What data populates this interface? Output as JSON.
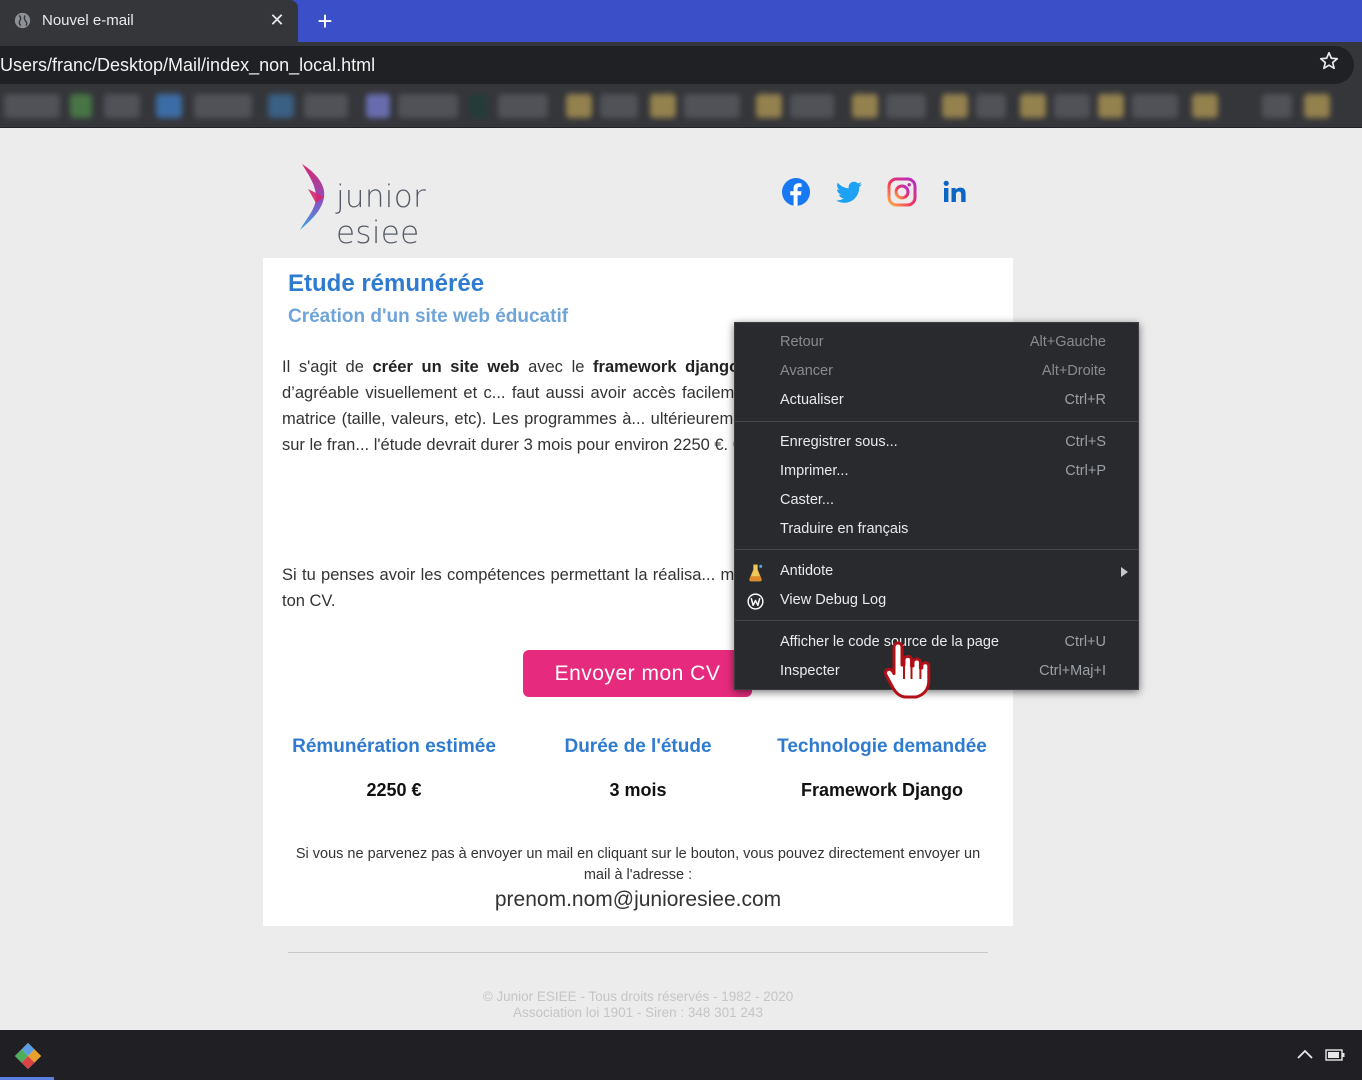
{
  "browser": {
    "tab_title": "Nouvel e-mail",
    "tab_close": "✕",
    "new_tab": "+",
    "url": "Users/franc/Desktop/Mail/index_non_local.html"
  },
  "header": {
    "logo_text": "junior esiee",
    "social": [
      "facebook-icon",
      "twitter-icon",
      "instagram-icon",
      "linkedin-icon"
    ]
  },
  "card": {
    "title": "Etude rémunérée",
    "subtitle": "Création d'un site web éducatif",
    "para1": [
      {
        "t": "Il s'agit de "
      },
      {
        "t": "créer un site web",
        "b": true
      },
      {
        "t": " avec le "
      },
      {
        "t": "framework django",
        "b": true
      },
      {
        "t": ", ... donc il faudra quelque chose d’agréable visuellement et c... faut aussi avoir accès facilement à diverses options, com... d'une matrice (taille, valeurs, etc). Les programmes à... ultérieurement par le client. Des connaissances sur le fran... l'étude devrait durer 3 mois pour environ 2250 €. Ces co... fonction de votre expertise."
      }
    ],
    "para2": "Si tu penses avoir les compétences permettant la réalisa... motivé(e), n’hésite pas et envoie nous ton CV.",
    "cta": "Envoyer mon CV",
    "info": [
      {
        "label": "Rémunération estimée",
        "value": "2250 €"
      },
      {
        "label": "Durée de l'étude",
        "value": "3 mois"
      },
      {
        "label": "Technologie demandée",
        "value": "Framework Django"
      }
    ],
    "note": "Si vous ne parvenez pas à envoyer un mail en cliquant sur le bouton, vous pouvez directement envoyer un mail à l'adresse :",
    "email": "prenom.nom@junioresiee.com"
  },
  "footer": {
    "line1": "© Junior ESIEE - Tous droits réservés - 1982 - 2020",
    "line2": "Association loi 1901 - Siren : 348 301 243"
  },
  "context_menu": {
    "items": [
      {
        "label": "Retour",
        "shortcut": "Alt+Gauche",
        "disabled": true
      },
      {
        "label": "Avancer",
        "shortcut": "Alt+Droite",
        "disabled": true
      },
      {
        "label": "Actualiser",
        "shortcut": "Ctrl+R"
      },
      {
        "label": "Enregistrer sous...",
        "shortcut": "Ctrl+S"
      },
      {
        "label": "Imprimer...",
        "shortcut": "Ctrl+P"
      },
      {
        "label": "Caster..."
      },
      {
        "label": "Traduire en français"
      },
      {
        "label": "Antidote",
        "icon": "antidote-icon",
        "submenu": true
      },
      {
        "label": "View Debug Log",
        "icon": "debug-log-icon"
      },
      {
        "label": "Afficher le code source de la page",
        "shortcut": "Ctrl+U"
      },
      {
        "label": "Inspecter",
        "shortcut": "Ctrl+Maj+I"
      }
    ]
  },
  "colors": {
    "accent_blue": "#2f7bd0",
    "cta_pink": "#e62a7d",
    "tab_strip": "#3b4fc8"
  }
}
